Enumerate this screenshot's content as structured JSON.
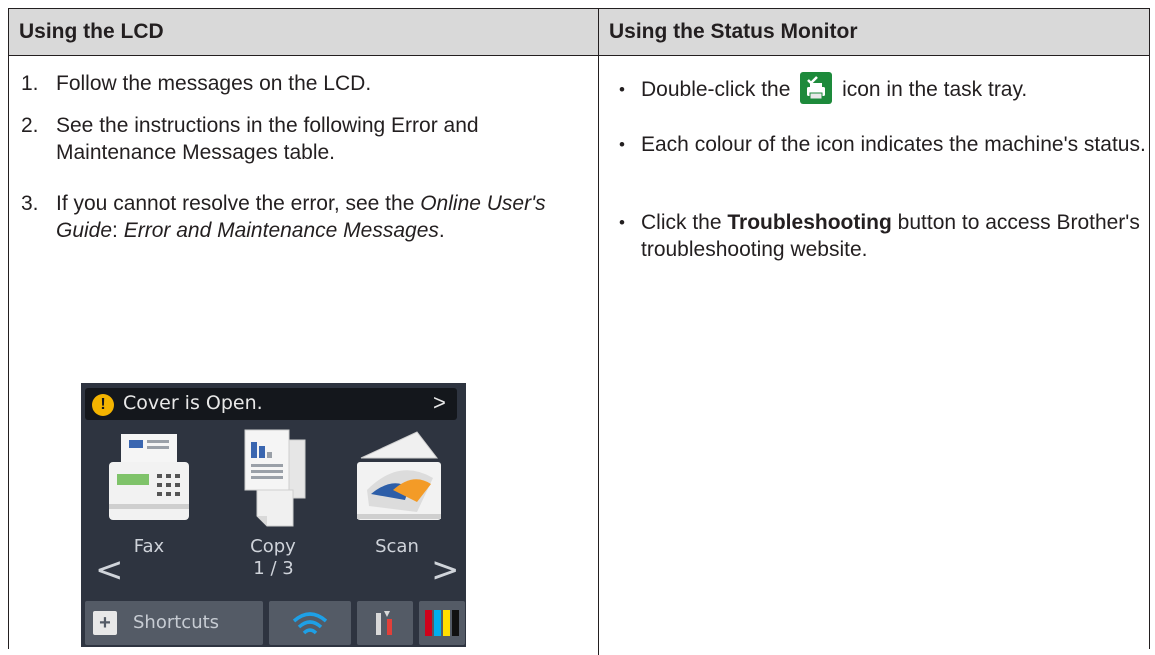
{
  "table": {
    "headers": [
      "Using the LCD",
      "Using the Status Monitor"
    ]
  },
  "lcd_steps": [
    {
      "num": "1.",
      "text": "Follow the messages on the LCD."
    },
    {
      "num": "2.",
      "text": "See the instructions in the following Error and Maintenance Messages table."
    },
    {
      "num": "3.",
      "text_before": "If you cannot resolve the error, see the ",
      "ref_guide": "Online User's Guide",
      "sep": ": ",
      "ref_topic": "Error and Maintenance Messages",
      "end": "."
    }
  ],
  "status_monitor_bullets": [
    {
      "before": "Double-click the ",
      "icon": "status-monitor-tray-icon",
      "after": " icon in the task tray."
    },
    {
      "text": "Each colour of the icon indicates the machine's status."
    },
    {
      "before": "Click the ",
      "bold": "Troubleshooting",
      "after": " button to access Brother's troubleshooting website."
    }
  ],
  "lcd_screen": {
    "message": "Cover is Open.",
    "apps": [
      {
        "label": "Fax",
        "icon": "fax-icon"
      },
      {
        "label": "Copy",
        "icon": "copy-icon"
      },
      {
        "label": "Scan",
        "icon": "scan-icon"
      }
    ],
    "page_indicator": "1 / 3",
    "dock": {
      "shortcuts_label": "Shortcuts",
      "icons": [
        "wifi-icon",
        "settings-tools-icon",
        "ink-icon"
      ]
    },
    "colors": {
      "background": "#2e3440",
      "warning": "#f4b400",
      "ink": [
        "#d0021b",
        "#00aeef",
        "#ffde00",
        "#111111"
      ]
    }
  }
}
